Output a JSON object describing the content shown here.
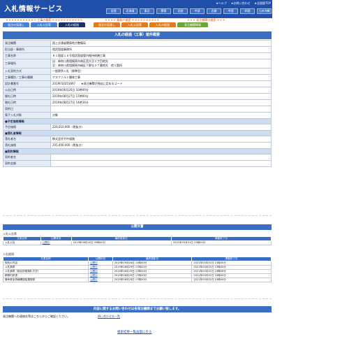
{
  "header": {
    "title": "入札情報サービス",
    "toplinks": [
      "★ヘルプ",
      "★お問い合わせ",
      "★全国版TOP"
    ],
    "regions": [
      "全国",
      "北海道",
      "東北",
      "関東",
      "北陸",
      "中部",
      "近畿",
      "中国",
      "四国",
      "九州沖縄"
    ]
  },
  "strip": {
    "construction": "＊＊＊＊＊＊＊＊＊＊＊ 工事の検索 ＊＊＊＊＊＊＊＊＊＊＊",
    "services": "＊＊＊＊ 業務の検索 ＊＊＊＊＊＊＊＊＊＊",
    "orderer": "＊＊＊ 発注機関の検索 ＊＊＊"
  },
  "tabs": [
    {
      "label": "発注の見通し",
      "style": "blue"
    },
    {
      "label": "入札公告等",
      "style": "blue"
    },
    {
      "label": "入札の経過",
      "style": "active"
    },
    {
      "label": "発注の見通し",
      "style": "orange"
    },
    {
      "label": "入札公告等",
      "style": "orange"
    },
    {
      "label": "入札の経過",
      "style": "orange"
    },
    {
      "label": "発注機関情報",
      "style": "green"
    }
  ],
  "page_title": "入札の経過（工事）案件概要",
  "main_rows": [
    {
      "label": "発注機関",
      "value": "国土交通省関東地方整備局"
    },
    {
      "label": "担当部・事務所",
      "value": "相武国道事務所"
    },
    {
      "label": "工事名称",
      "value": "Ｒ１国道１６号相武国道管内維持修繕工事"
    },
    {
      "label": "工事場所",
      "value": "自：神奈川県相模原市南区西大沼１丁目地先\n至：神奈川県相模原市緑区下野谷２７番地先　他１箇所"
    },
    {
      "label": "入札契約方式",
      "value": "一般競争入札（標準型）"
    },
    {
      "label": "工事種別／工事の種類",
      "value": "アスファルト舗装工事"
    },
    {
      "label": "設計書番号",
      "value": "2019010251697　　★発注機関が独自に定めるコード"
    },
    {
      "label": "公告日時",
      "value": "2019年06月20日 10時00分"
    },
    {
      "label": "開札日時",
      "value": "2019年08月27日 17時00分"
    },
    {
      "label": "開札日時",
      "value": "2019年08月27日 14時34分"
    },
    {
      "label": "契約日",
      "value": ""
    },
    {
      "label": "電子入札対象",
      "value": "対象"
    }
  ],
  "section_price": "■予定価格情報",
  "price_rows": [
    {
      "label": "予定価格",
      "value": "226,010,000（税抜き）"
    }
  ],
  "section_award": "■落札者情報",
  "award_rows": [
    {
      "label": "落札者名",
      "value": "株式会社竹中道路"
    },
    {
      "label": "落札価格",
      "value": "205,400,000（税抜き）"
    }
  ],
  "section_contract": "■契約情報",
  "contract_rows": [
    {
      "label": "契約者名",
      "value": ""
    },
    {
      "label": "契約金額",
      "value": ""
    }
  ],
  "public_docs": {
    "title": "公開文書",
    "section1": "入札公告等",
    "section2": "入札経過",
    "columns": [
      "文書名称",
      "公開状況",
      "最終更新日",
      "掲載終了日"
    ],
    "docs1": [
      {
        "name": "入札公告",
        "status": "公開中",
        "updated": "2019年06月20日 09時00分",
        "end": "2021年03月31日 23時00分"
      }
    ],
    "docs2": [
      {
        "name": "契約の内容",
        "status": "公開中",
        "updated": "2019年09月04日 10時00分",
        "end": "2021年03月31日 23時00分"
      },
      {
        "name": "入札調書",
        "status": "公開中",
        "updated": "2019年08月29日 17時00分",
        "end": "2021年03月31日 23時00分"
      },
      {
        "name": "入札調書（総合評価落札方式）",
        "status": "公開中",
        "updated": "2019年08月29日 17時00分",
        "end": "2021年03月31日 23時00分"
      },
      {
        "name": "積算内訳書",
        "status": "公開中",
        "updated": "2019年08月29日 17時00分",
        "end": "2021年03月31日 23時00分"
      },
      {
        "name": "競争参加資格確認結果調書",
        "status": "公開中",
        "updated": "2019年08月29日 17時00分",
        "end": "2021年03月31日 23時00分"
      }
    ]
  },
  "notice": "内容に関するお問い合わせは各発注機関までお願い致します。",
  "contact_text": "発注機関への連絡先等はこちらからご確認ください。",
  "contact_link": "問い合わせ先一覧",
  "back_link": "検索結果一覧画面に戻る",
  "colors": {
    "header": "#1f4fa8",
    "bar": "#3a6ec2",
    "accent": "#e07b22",
    "green": "#6ca636"
  }
}
